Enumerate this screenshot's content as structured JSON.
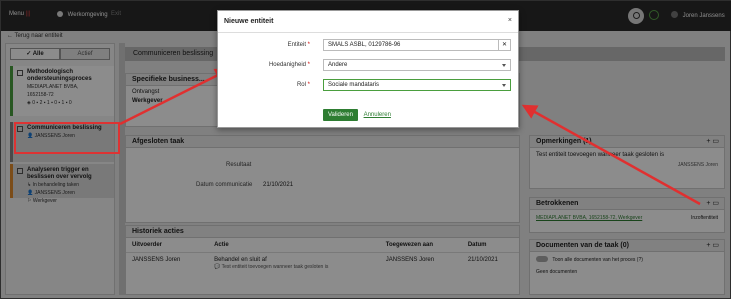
{
  "topbar": {
    "menu_label": "Menu",
    "menu_sep": "|||",
    "app_label": "Werkomgeving",
    "ext_label": "Exit",
    "user_name": "Joren Janssens"
  },
  "back_link": "← Terug naar entiteit",
  "sidebar": {
    "tab_all": "✓ Alle",
    "tab_active": "Actief",
    "tasks": [
      {
        "title": "Methodologisch ondersteuningsproces",
        "sub1": "MEDIAPLANET BVBA,",
        "sub2": "1652158-72",
        "sub3": "◈ 0 ▪ 2 ▪ 1 ▪ 0 ▪ 1 ▪ 0"
      },
      {
        "title": "Communiceren beslissing",
        "sub1": "👤 JANSSENS Joren"
      },
      {
        "title": "Analyseren trigger en beslissen over vervolg",
        "sub1": "↳ In behandeling taken",
        "sub2": "👤 JANSSENS Joren",
        "sub3": "⚐ Werkgever"
      }
    ]
  },
  "main": {
    "title": "Communiceren beslissing",
    "spec_header": "Specifieke business...",
    "spec_row1_label": "Ontvangst",
    "spec_row1_value": "Werkgever",
    "afg_header": "Afgesloten taak",
    "afg_k1": "Resultaat",
    "afg_k2": "Datum communicatie",
    "afg_v2": "21/10/2021",
    "hist_header": "Historiek acties",
    "hist_cols": [
      "Uitvoerder",
      "Actie",
      "Toegewezen aan",
      "Datum"
    ],
    "hist_row": {
      "uitvoerder": "JANSSENS Joren",
      "actie": "Behandel en sluit af",
      "actie_sub": "💬 Test entiteit toevoegen wanneer taak gesloten is",
      "toegewezen": "JANSSENS Joren",
      "datum": "21/10/2021"
    },
    "opm_header": "Opmerkingen (1)",
    "opm_text": "Test entiteit toevoegen wanneer taak gesloten is",
    "opm_author": "JANSSENS Joren",
    "bet_header": "Betrokkenen",
    "bet_link": "MEDIAPLANET BVBA, 1652158-72, Werkgever",
    "bet_tag": "Inzoftentiteit",
    "doc_header": "Documenten van de taak (0)",
    "doc_toggle": "Toon alle documenten van het proces (?)",
    "doc_empty": "Geen documenten"
  },
  "modal": {
    "title": "Nieuwe entiteit",
    "close": "×",
    "f1_label": "Entiteit",
    "f1_value": "SMALS ASBL, 0129786-96",
    "f1_clear": "✕",
    "f2_label": "Hoedanigheid",
    "f2_value": "Andere",
    "f3_label": "Rol",
    "f3_value": "Sociale mandataris",
    "req": "*",
    "submit": "Valideren",
    "cancel": "Annuleren"
  },
  "colors": {
    "accent": "#2e7d32",
    "arrow": "#e03030",
    "topbar": "#2b2b2b"
  }
}
